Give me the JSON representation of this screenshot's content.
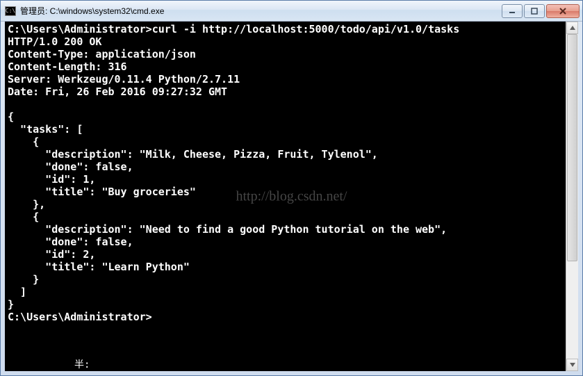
{
  "window": {
    "icon_text": "C:\\",
    "title": "管理员: C:\\windows\\system32\\cmd.exe"
  },
  "controls": {
    "minimize": "minimize",
    "maximize": "maximize",
    "close": "close"
  },
  "terminal": {
    "prompt1": "C:\\Users\\Administrator>",
    "command": "curl -i http://localhost:5000/todo/api/v1.0/tasks",
    "http_status": "HTTP/1.0 200 OK",
    "header_content_type": "Content-Type: application/json",
    "header_content_length": "Content-Length: 316",
    "header_server": "Server: Werkzeug/0.11.4 Python/2.7.11",
    "header_date": "Date: Fri, 26 Feb 2016 09:27:32 GMT",
    "json_open": "{",
    "json_tasks_open": "  \"tasks\": [",
    "json_obj1_open": "    {",
    "json_obj1_desc": "      \"description\": \"Milk, Cheese, Pizza, Fruit, Tylenol\",",
    "json_obj1_done": "      \"done\": false,",
    "json_obj1_id": "      \"id\": 1,",
    "json_obj1_title": "      \"title\": \"Buy groceries\"",
    "json_obj1_close": "    },",
    "json_obj2_open": "    {",
    "json_obj2_desc": "      \"description\": \"Need to find a good Python tutorial on the web\",",
    "json_obj2_done": "      \"done\": false,",
    "json_obj2_id": "      \"id\": 2,",
    "json_obj2_title": "      \"title\": \"Learn Python\"",
    "json_obj2_close": "    }",
    "json_tasks_close": "  ]",
    "json_close": "}",
    "prompt2": "C:\\Users\\Administrator>",
    "ime": "半:"
  },
  "watermark": "http://blog.csdn.net/"
}
